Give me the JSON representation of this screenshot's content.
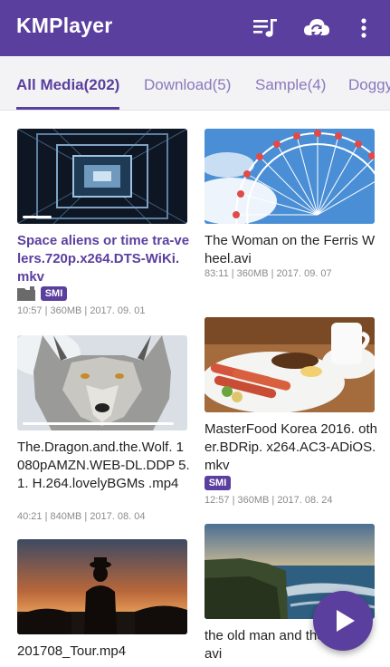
{
  "app": {
    "title": "KMPlayer",
    "icons": [
      "playlist-icon",
      "cloud-sync-icon",
      "more-vert-icon"
    ]
  },
  "tabs": [
    {
      "label": "All Media(202)",
      "active": true
    },
    {
      "label": "Download(5)",
      "active": false
    },
    {
      "label": "Sample(4)",
      "active": false
    },
    {
      "label": "Doggy",
      "active": false
    }
  ],
  "videos": [
    {
      "title": "Space aliens or time tra-velers.720p.x264.DTS-WiKi. mkv",
      "meta": "10:57 | 360MB | 2017. 09. 01",
      "badge": "SMI",
      "highlighted": true,
      "progress": 0.18
    },
    {
      "title": "The Woman on the Ferris Wheel.avi",
      "meta": "83:11 | 360MB | 2017. 09. 07",
      "badge": "",
      "highlighted": false,
      "progress": 0
    },
    {
      "title": "The.Dragon.and.the.Wolf. 1080pAMZN.WEB-DL.DDP 5.1. H.264.lovelyBGMs .mp4",
      "meta": "40:21 | 840MB | 2017. 08. 04",
      "badge": "",
      "highlighted": false,
      "progress": 0.95
    },
    {
      "title": "MasterFood Korea 2016. other.BDRip. x264.AC3-ADiOS.mkv",
      "meta": "12:57 | 360MB | 2017. 08. 24",
      "badge": "SMI",
      "highlighted": false,
      "progress": 0
    },
    {
      "title": "201708_Tour.mp4",
      "meta": "",
      "badge": "",
      "highlighted": false,
      "progress": 0
    },
    {
      "title": "the old man and the sea.avi",
      "meta": "",
      "badge": "",
      "highlighted": false,
      "progress": 0
    }
  ],
  "colors": {
    "brand": "#5b3f9e",
    "tab_inactive": "#8a78bd"
  },
  "fab": {
    "icon": "play-icon"
  }
}
